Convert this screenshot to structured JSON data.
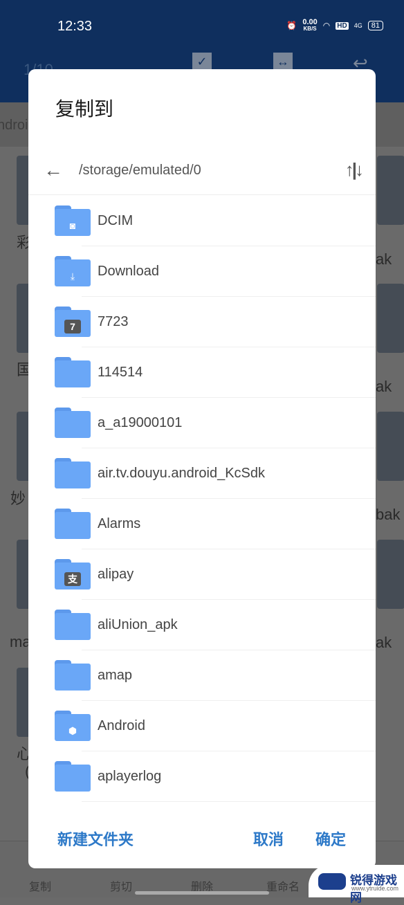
{
  "status_bar": {
    "time": "12:33",
    "net_speed": "0.00",
    "net_unit": "KB/S",
    "hd": "HD",
    "signal": "4G",
    "battery": "81"
  },
  "background": {
    "count": "1/10",
    "breadcrumb": "ndroi",
    "left_fragments": [
      "彩",
      "国",
      "妙",
      "ma",
      "心",
      "("
    ],
    "right_fragments": [
      "ak",
      "ak",
      "bak",
      "ak"
    ],
    "bottom_bar": [
      "复制",
      "剪切",
      "删除",
      "重命名"
    ]
  },
  "dialog": {
    "title": "复制到",
    "path": "/storage/emulated/0",
    "folders": [
      {
        "name": "DCIM",
        "icon": "camera"
      },
      {
        "name": "Download",
        "icon": "download"
      },
      {
        "name": "7723",
        "icon": "app-7723"
      },
      {
        "name": "114514",
        "icon": "none"
      },
      {
        "name": "a_a19000101",
        "icon": "none"
      },
      {
        "name": "air.tv.douyu.android_KcSdk",
        "icon": "none"
      },
      {
        "name": "Alarms",
        "icon": "none"
      },
      {
        "name": "alipay",
        "icon": "alipay"
      },
      {
        "name": "aliUnion_apk",
        "icon": "none"
      },
      {
        "name": "amap",
        "icon": "none"
      },
      {
        "name": "Android",
        "icon": "settings"
      },
      {
        "name": "aplayerlog",
        "icon": "none"
      }
    ],
    "new_folder": "新建文件夹",
    "cancel": "取消",
    "confirm": "确定"
  },
  "watermark": {
    "title": "锐得游戏网",
    "url": "www.ytruide.com"
  },
  "colors": {
    "accent": "#2d79c8",
    "folder": "#6aa7f7",
    "topbar": "#0f2f5e"
  }
}
